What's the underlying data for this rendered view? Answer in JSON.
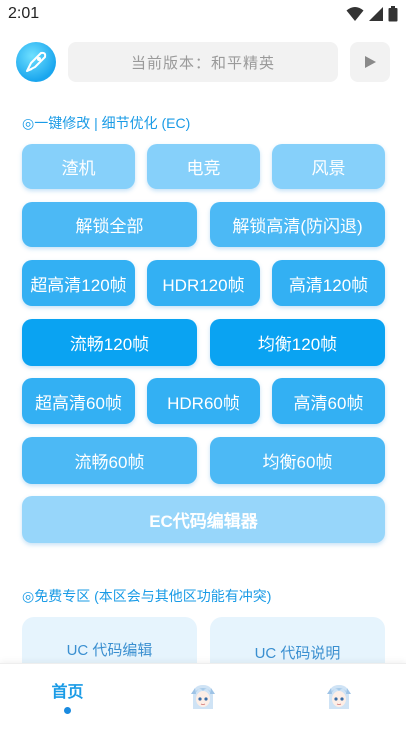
{
  "status": {
    "time": "2:01"
  },
  "header": {
    "version_text": "当前版本：和平精英"
  },
  "section1": {
    "title": "◎一键修改 | 细节优化 (EC)"
  },
  "buttons": {
    "row1": [
      "渣机",
      "电竞",
      "风景"
    ],
    "row2": [
      "解锁全部",
      "解锁高清(防闪退)"
    ],
    "row3": [
      "超高清120帧",
      "HDR120帧",
      "高清120帧"
    ],
    "row4": [
      "流畅120帧",
      "均衡120帧"
    ],
    "row5": [
      "超高清60帧",
      "HDR60帧",
      "高清60帧"
    ],
    "row6": [
      "流畅60帧",
      "均衡60帧"
    ],
    "editor": "EC代码编辑器"
  },
  "section2": {
    "title": "◎免费专区 (本区会与其他区功能有冲突)"
  },
  "uc_cards": [
    "UC 代码编辑",
    "UC 代码说明"
  ],
  "nav": {
    "home_label": "首页"
  },
  "colors": {
    "accent": "#1a9be6",
    "light_button": "#86d0fa",
    "mid_button": "#4cb9f5",
    "dark_button": "#0aa3f2"
  }
}
